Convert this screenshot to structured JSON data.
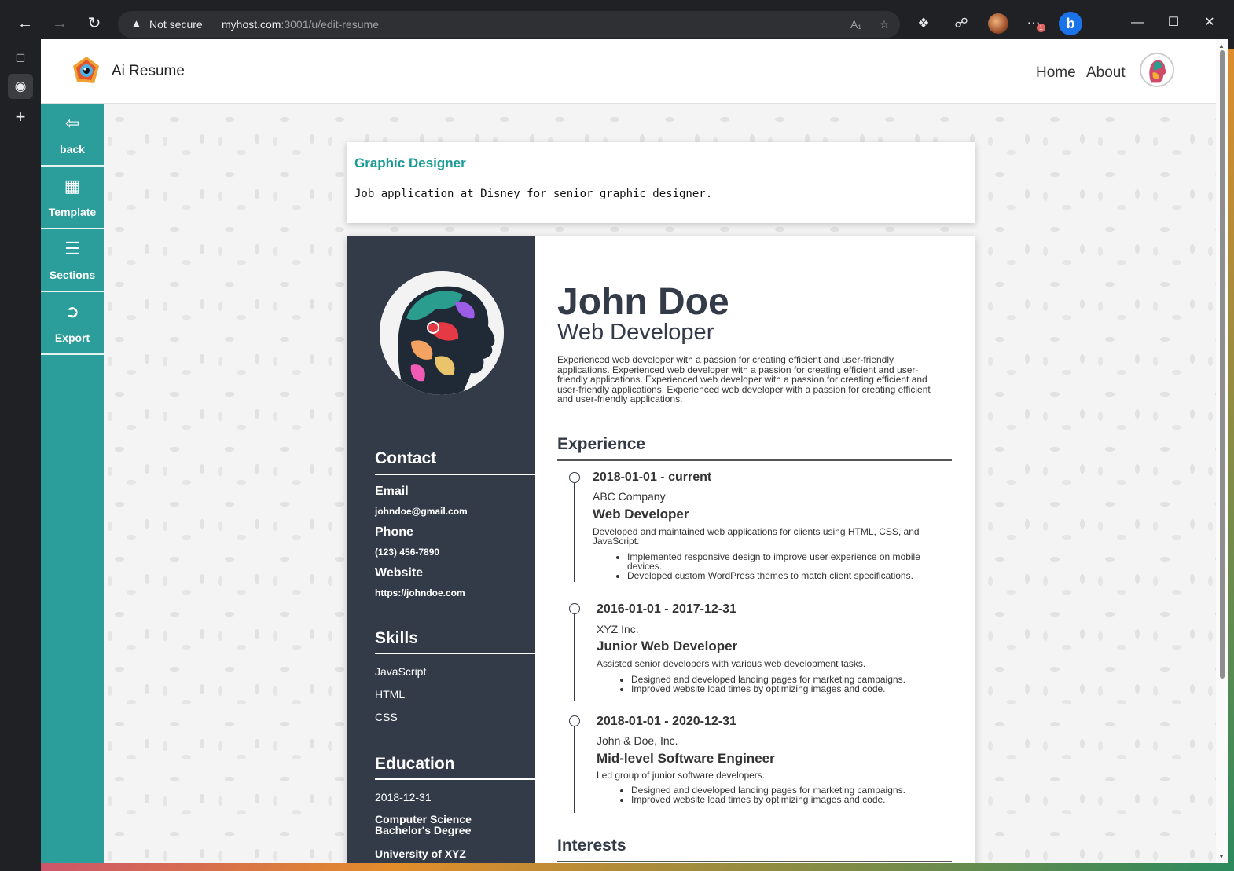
{
  "browser": {
    "security_text": "Not secure",
    "url_host": "myhost.com",
    "url_rest": ":3001/u/edit-resume",
    "badge_count": "1"
  },
  "app": {
    "title": "Ai Resume",
    "nav": [
      "Home",
      "About"
    ]
  },
  "sidemenu": [
    {
      "label": "back",
      "icon": "arrow-back-icon"
    },
    {
      "label": "Template",
      "icon": "template-icon"
    },
    {
      "label": "Sections",
      "icon": "list-icon"
    },
    {
      "label": "Export",
      "icon": "export-icon"
    }
  ],
  "job": {
    "title": "Graphic Designer",
    "description": "Job application at Disney for senior graphic designer."
  },
  "resume": {
    "name": "John Doe",
    "role": "Web Developer",
    "summary": "Experienced web developer with a passion for creating efficient and user-friendly applications. Experienced web developer with a passion for creating efficient and user-friendly applications. Experienced web developer with a passion for creating efficient and user-friendly applications. Experienced web developer with a passion for creating efficient and user-friendly applications.",
    "contact": {
      "heading": "Contact",
      "email_label": "Email",
      "email": "johndoe@gmail.com",
      "phone_label": "Phone",
      "phone": "(123) 456-7890",
      "website_label": "Website",
      "website": "https://johndoe.com"
    },
    "skills": {
      "heading": "Skills",
      "items": [
        "JavaScript",
        "HTML",
        "CSS"
      ]
    },
    "education": {
      "heading": "Education",
      "date": "2018-12-31",
      "degree": "Computer Science Bachelor's Degree",
      "school": "University of XYZ"
    },
    "experience": {
      "heading": "Experience",
      "items": [
        {
          "date": "2018-01-01 - current",
          "company": "ABC Company",
          "title": "Web Developer",
          "desc": "Developed and maintained web applications for clients using HTML, CSS, and JavaScript.",
          "bullets": [
            "Implemented responsive design to improve user experience on mobile devices.",
            "Developed custom WordPress themes to match client specifications."
          ]
        },
        {
          "date": "2016-01-01 - 2017-12-31",
          "company": "XYZ Inc.",
          "title": "Junior Web Developer",
          "desc": "Assisted senior developers with various web development tasks.",
          "bullets": [
            "Designed and developed landing pages for marketing campaigns.",
            "Improved website load times by optimizing images and code."
          ]
        },
        {
          "date": "2018-01-01 - 2020-12-31",
          "company": "John & Doe, Inc.",
          "title": "Mid-level Software Engineer",
          "desc": "Led group of junior software developers.",
          "bullets": [
            "Designed and developed landing pages for marketing campaigns.",
            "Improved website load times by optimizing images and code."
          ]
        }
      ]
    },
    "interests_heading": "Interests"
  },
  "colors": {
    "accent": "#2b9d9a",
    "resume_dark": "#333a48",
    "job_title": "#1a9a95"
  }
}
